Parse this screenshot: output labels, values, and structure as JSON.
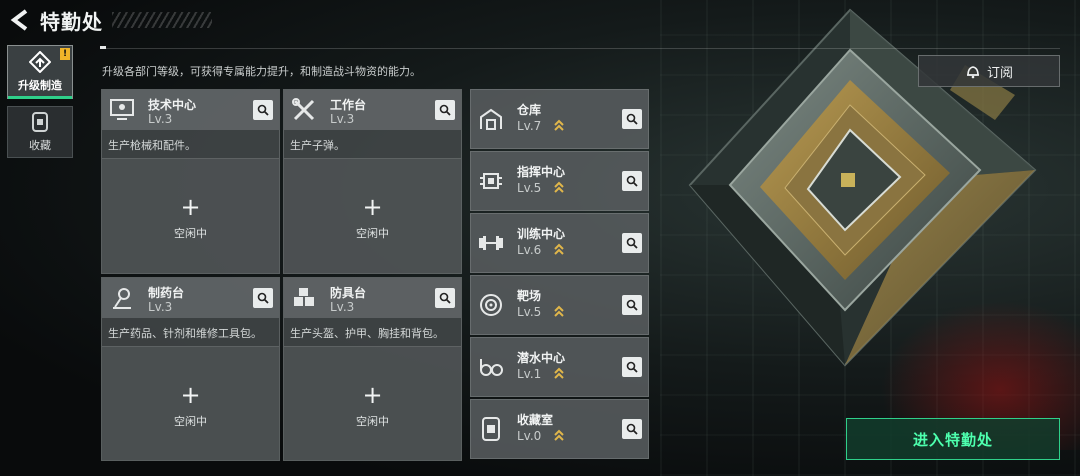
{
  "header": {
    "title": "特勤处"
  },
  "tabs": [
    {
      "label": "升级制造",
      "icon": "upgrade-icon",
      "active": true,
      "badge": "!"
    },
    {
      "label": "收藏",
      "icon": "collection-icon",
      "active": false
    }
  ],
  "description": "升级各部门等级，可获得专属能力提升，和制造战斗物资的能力。",
  "facilities": [
    {
      "name": "技术中心",
      "level": "Lv.3",
      "icon": "monitor-icon",
      "desc": "生产枪械和配件。",
      "slot_status": "空闲中"
    },
    {
      "name": "工作台",
      "level": "Lv.3",
      "icon": "tools-icon",
      "desc": "生产子弹。",
      "slot_status": "空闲中"
    },
    {
      "name": "制药台",
      "level": "Lv.3",
      "icon": "microscope-icon",
      "desc": "生产药品、针剂和维修工具包。",
      "slot_status": "空闲中"
    },
    {
      "name": "防具台",
      "level": "Lv.3",
      "icon": "armor-icon",
      "desc": "生产头盔、护甲、胸挂和背包。",
      "slot_status": "空闲中"
    }
  ],
  "rooms": [
    {
      "name": "仓库",
      "level": "Lv.7",
      "icon": "warehouse-icon",
      "upgradable": true
    },
    {
      "name": "指挥中心",
      "level": "Lv.5",
      "icon": "chip-icon",
      "upgradable": true
    },
    {
      "name": "训练中心",
      "level": "Lv.6",
      "icon": "dumbbell-icon",
      "upgradable": true
    },
    {
      "name": "靶场",
      "level": "Lv.5",
      "icon": "target-icon",
      "upgradable": true
    },
    {
      "name": "潜水中心",
      "level": "Lv.1",
      "icon": "goggles-icon",
      "upgradable": true
    },
    {
      "name": "收藏室",
      "level": "Lv.0",
      "icon": "vault-icon",
      "upgradable": true
    }
  ],
  "subscribe_label": "订阅",
  "enter_label": "进入特勤处",
  "colors": {
    "accent_green": "#2fd08a",
    "upgrade_gold": "#e0b64a",
    "badge_yellow": "#f0b429"
  }
}
